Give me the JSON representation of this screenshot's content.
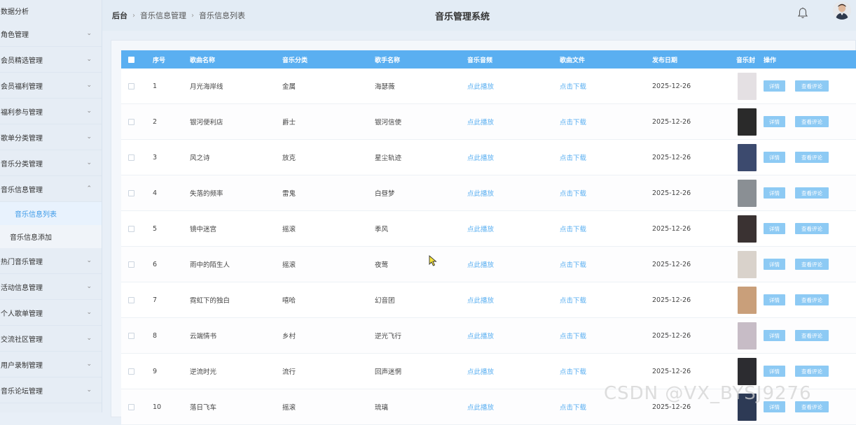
{
  "sidebar": {
    "items": [
      {
        "label": "数据分析"
      },
      {
        "label": "角色管理"
      },
      {
        "label": "会员精选管理"
      },
      {
        "label": "会员福利管理"
      },
      {
        "label": "福利参与管理"
      },
      {
        "label": "歌单分类管理"
      },
      {
        "label": "音乐分类管理"
      },
      {
        "label": "音乐信息管理"
      },
      {
        "label": "热门音乐管理"
      },
      {
        "label": "活动信息管理"
      },
      {
        "label": "个人歌单管理"
      },
      {
        "label": "交流社区管理"
      },
      {
        "label": "用户录制管理"
      },
      {
        "label": "音乐论坛管理"
      }
    ],
    "submenu": [
      {
        "label": "音乐信息列表"
      },
      {
        "label": "音乐信息添加"
      }
    ]
  },
  "header": {
    "breadcrumb": [
      "后台",
      "音乐信息管理",
      "音乐信息列表"
    ],
    "title": "音乐管理系统"
  },
  "table": {
    "columns": [
      "序号",
      "歌曲名称",
      "音乐分类",
      "歌手名称",
      "音乐音频",
      "歌曲文件",
      "发布日期",
      "音乐封",
      "操作"
    ],
    "action_detail": "详情",
    "action_comments": "查看评论",
    "rows": [
      {
        "no": "1",
        "name": "月光海岸线",
        "category": "金属",
        "artist": "海瑟薇",
        "audio": "点此播放",
        "file": "点击下载",
        "date": "2025-12-26",
        "cover": "#e4e0e3"
      },
      {
        "no": "2",
        "name": "银河便利店",
        "category": "爵士",
        "artist": "银河信使",
        "audio": "点此播放",
        "file": "点击下载",
        "date": "2025-12-26",
        "cover": "#2a2a2a"
      },
      {
        "no": "3",
        "name": "风之诗",
        "category": "放克",
        "artist": "星尘轨迹",
        "audio": "点此播放",
        "file": "点击下载",
        "date": "2025-12-26",
        "cover": "#3c4a6e"
      },
      {
        "no": "4",
        "name": "失落的频率",
        "category": "雷鬼",
        "artist": "白昼梦",
        "audio": "点此播放",
        "file": "点击下载",
        "date": "2025-12-26",
        "cover": "#8a8f94"
      },
      {
        "no": "5",
        "name": "镜中迷宫",
        "category": "摇滚",
        "artist": "季风",
        "audio": "点此播放",
        "file": "点击下载",
        "date": "2025-12-26",
        "cover": "#3a3232"
      },
      {
        "no": "6",
        "name": "雨中的陌生人",
        "category": "摇滚",
        "artist": "夜莺",
        "audio": "点此播放",
        "file": "点击下载",
        "date": "2025-12-26",
        "cover": "#d9d2cb"
      },
      {
        "no": "7",
        "name": "霓虹下的独白",
        "category": "嘻哈",
        "artist": "幻音团",
        "audio": "点此播放",
        "file": "点击下载",
        "date": "2025-12-26",
        "cover": "#c99f7a"
      },
      {
        "no": "8",
        "name": "云端情书",
        "category": "乡村",
        "artist": "逆光飞行",
        "audio": "点此播放",
        "file": "点击下载",
        "date": "2025-12-26",
        "cover": "#c7bcc6"
      },
      {
        "no": "9",
        "name": "逆流时光",
        "category": "流行",
        "artist": "回声迷惘",
        "audio": "点此播放",
        "file": "点击下载",
        "date": "2025-12-26",
        "cover": "#2c2c30"
      },
      {
        "no": "10",
        "name": "落日飞车",
        "category": "摇滚",
        "artist": "琉璃",
        "audio": "点此播放",
        "file": "点击下载",
        "date": "2025-12-26",
        "cover": "#2d3a55"
      }
    ]
  },
  "watermark": "CSDN @VX_BYSJ9276",
  "colors": {
    "header_row": "#5aaff1",
    "link": "#5aaff1",
    "button": "#8dcaf4",
    "active_menu": "#3d9ae8"
  }
}
